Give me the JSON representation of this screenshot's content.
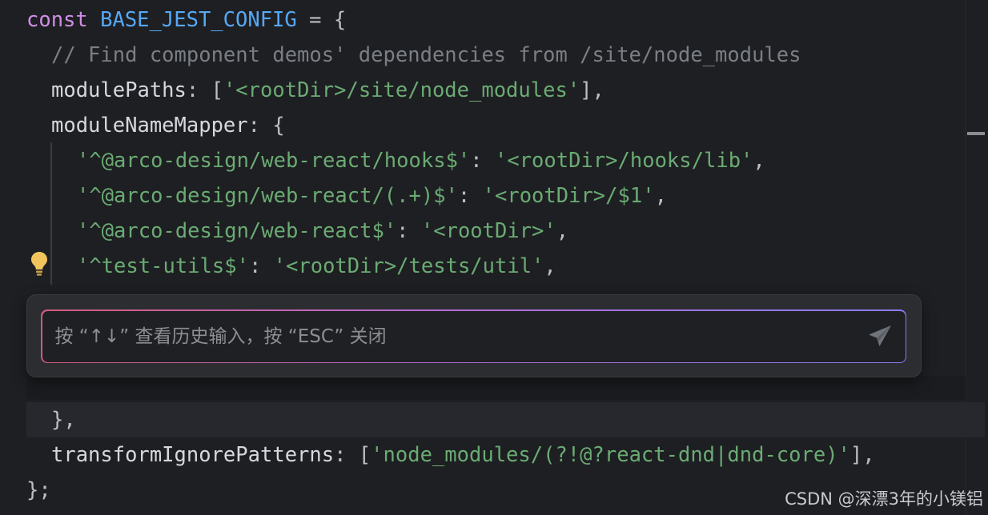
{
  "colors": {
    "background": "#1e1f22",
    "keyword": "#cf8ee8",
    "constant": "#56a8f5",
    "comment": "#7a7e85",
    "string": "#6aab73",
    "text": "#bcbec4",
    "input_border_gradient": [
      "#d25a7a",
      "#b46ad4",
      "#8a7cf0"
    ]
  },
  "code": {
    "line1": {
      "kw": "const",
      "name": "BASE_JEST_CONFIG",
      "rest": " = {"
    },
    "line2": {
      "comment": "// Find component demos' dependencies from /site/node_modules"
    },
    "line3": {
      "key": "modulePaths",
      "colon": ": [",
      "value": "'<rootDir>/site/node_modules'",
      "end": "],"
    },
    "line4": {
      "key": "moduleNameMapper",
      "rest": ": {"
    },
    "line5": {
      "key": "'^@arco-design/web-react/hooks$'",
      "colon": ": ",
      "value": "'<rootDir>/hooks/lib'",
      "end": ","
    },
    "line6": {
      "key": "'^@arco-design/web-react/(.+)$'",
      "colon": ": ",
      "value": "'<rootDir>/$1'",
      "end": ","
    },
    "line7": {
      "key": "'^@arco-design/web-react$'",
      "colon": ": ",
      "value": "'<rootDir>'",
      "end": ","
    },
    "line8": {
      "key": "'^test-utils$'",
      "colon": ": ",
      "value": "'<rootDir>/tests/util'",
      "end": ","
    },
    "line9": {
      "text": "},"
    },
    "line10": {
      "key": "transformIgnorePatterns",
      "colon": ": [",
      "value": "'node_modules/(?!@?react-dnd|dnd-core)'",
      "end": "],"
    },
    "line11": {
      "text": "};"
    }
  },
  "icons": {
    "intention": "lightbulb-icon",
    "send": "send-icon"
  },
  "ai_prompt": {
    "placeholder": "按 “↑↓” 查看历史输入，按 “ESC” 关闭",
    "value": ""
  },
  "watermark": "CSDN @深漂3年的小镁铝"
}
